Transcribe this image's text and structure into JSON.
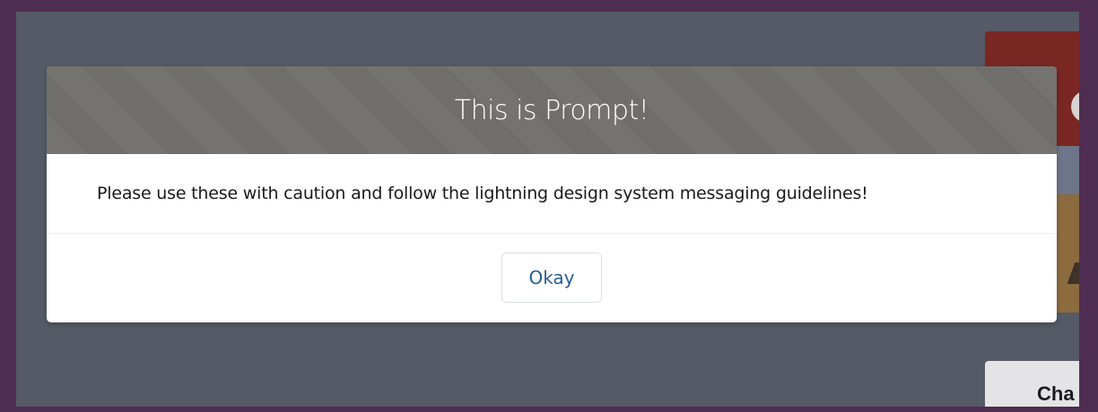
{
  "background": {
    "peek_text": "Cha"
  },
  "modal": {
    "title": "This is Prompt!",
    "message": "Please use these with caution and follow the lightning design system messaging guidelines!",
    "okay_label": "Okay"
  },
  "colors": {
    "frame_border": "#4f2d52",
    "backdrop": "#555a66",
    "header": "#706e6b",
    "button_text": "#2c5d93"
  }
}
